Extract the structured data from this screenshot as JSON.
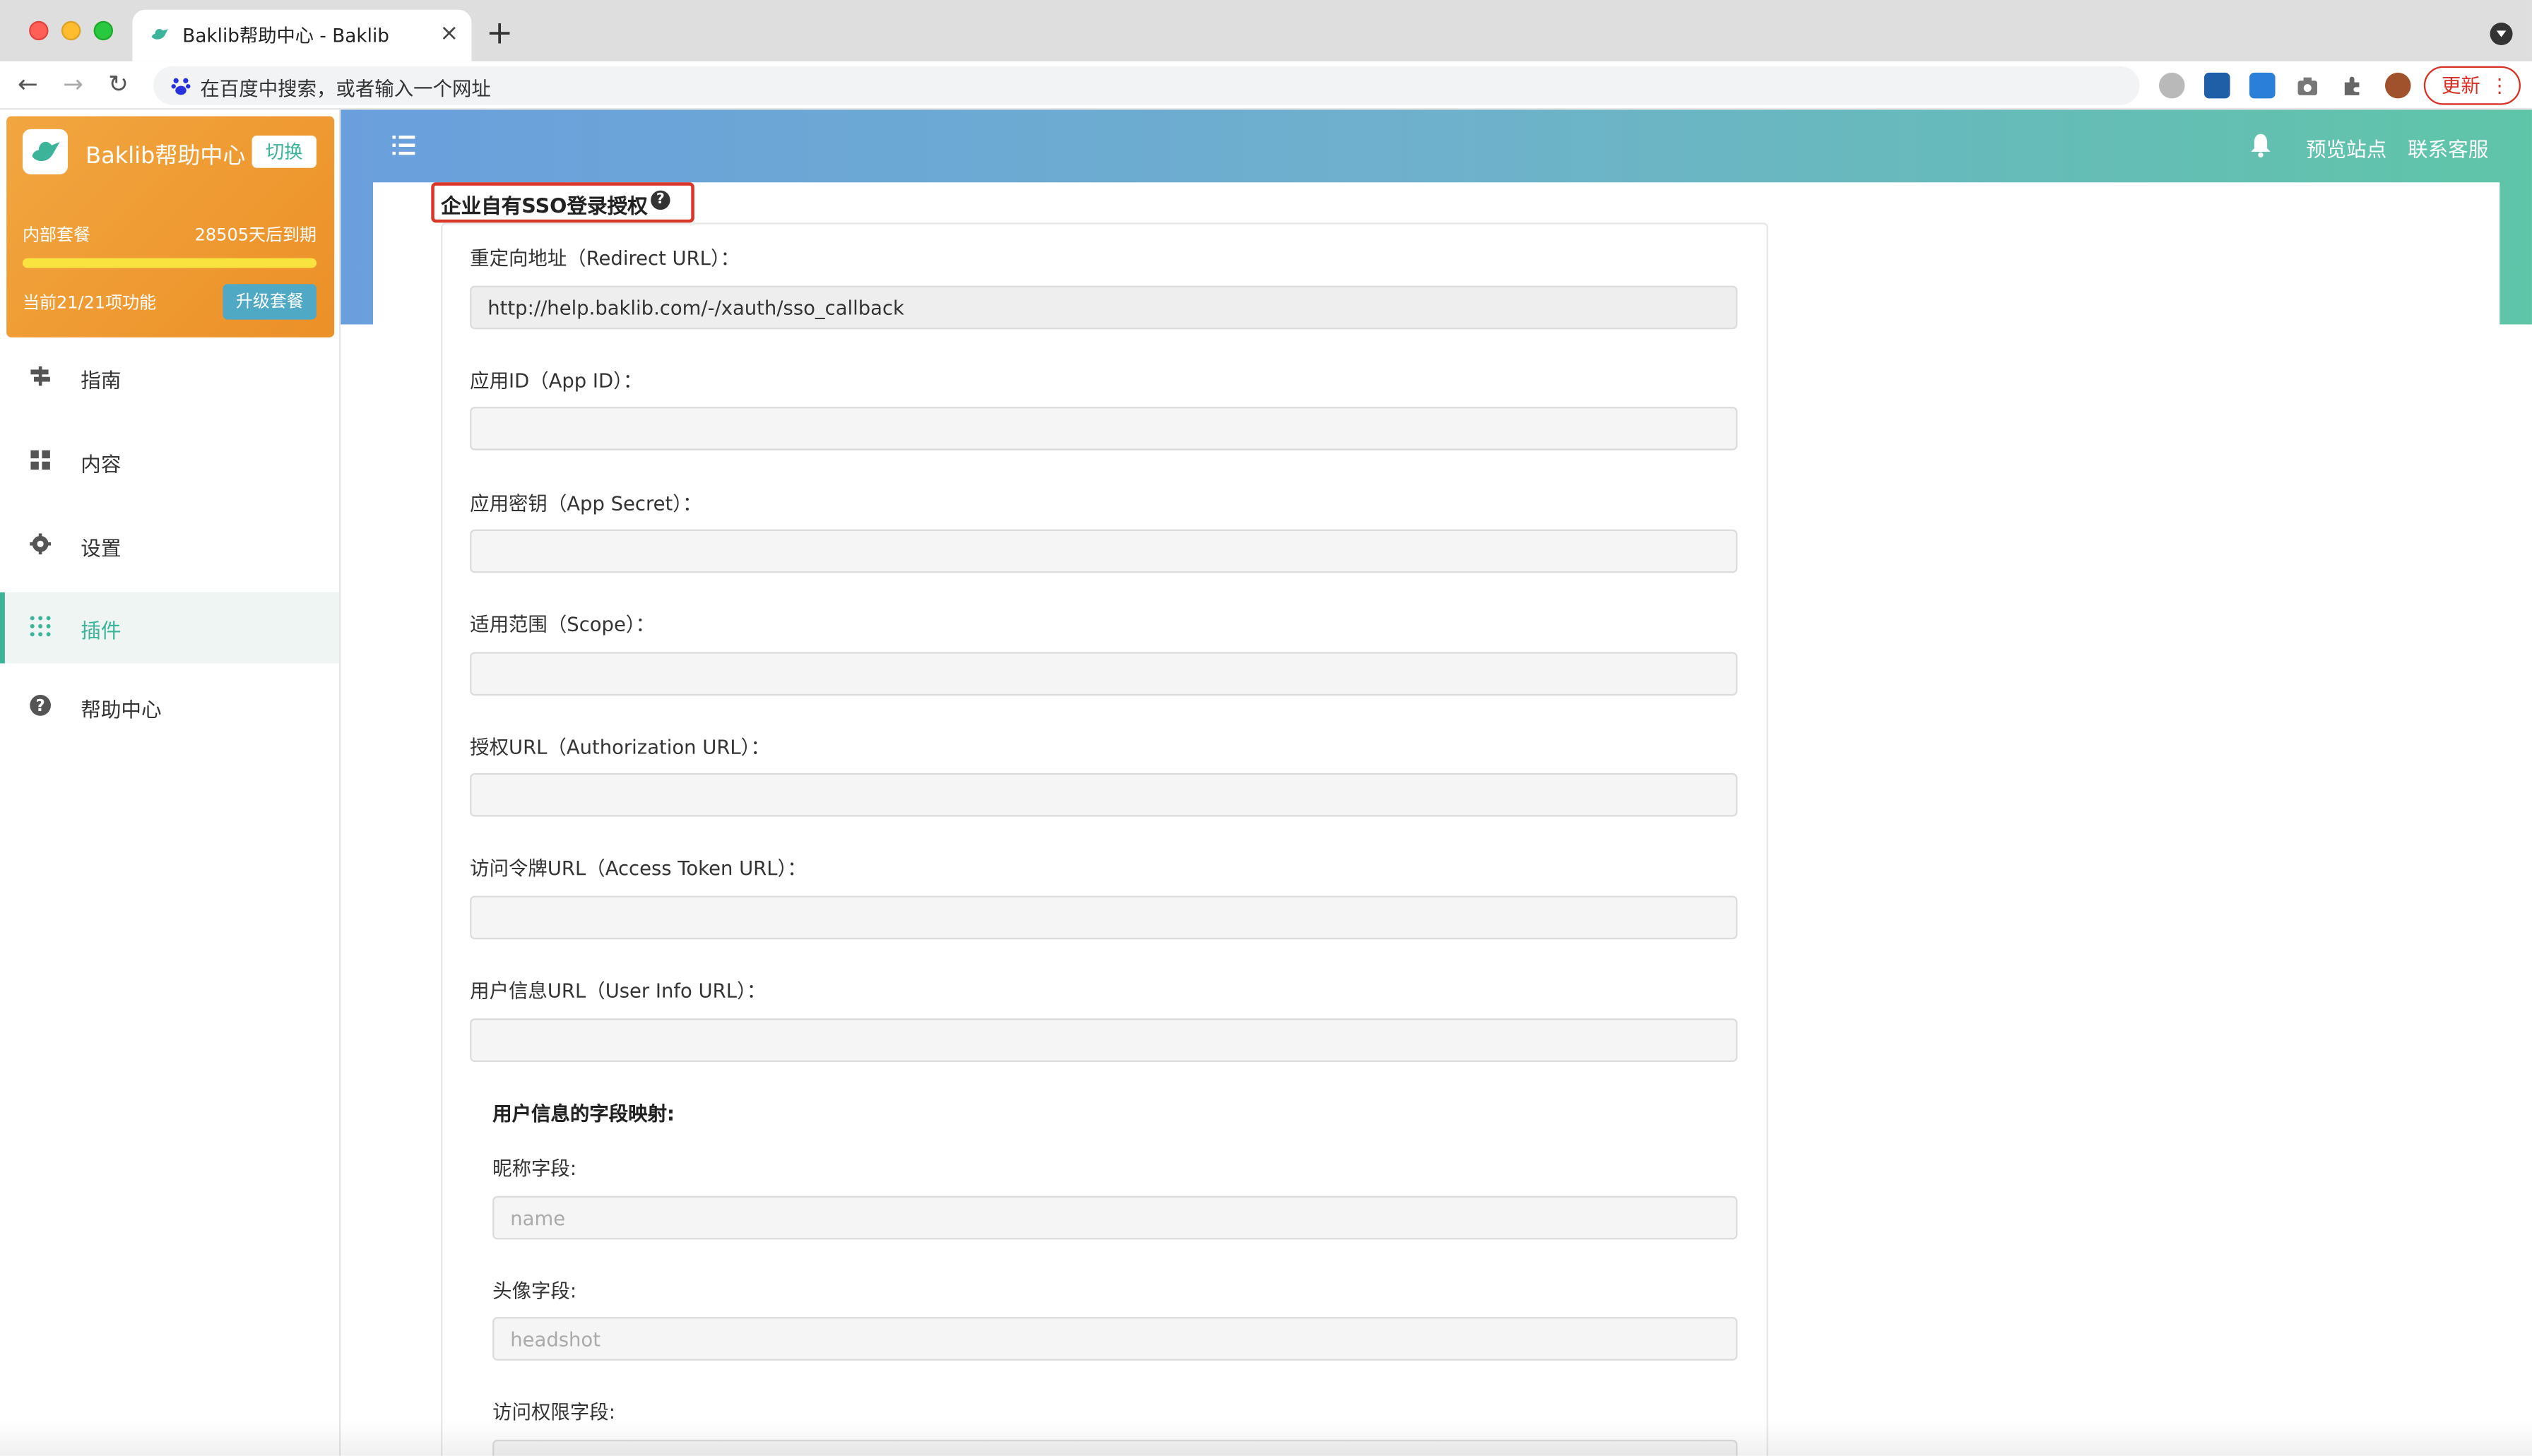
{
  "browser": {
    "tab_title": "Baklib帮助中心 - Baklib",
    "tab_close": "×",
    "new_tab": "+",
    "omnibox_text": "在百度中搜索，或者输入一个网址",
    "update_label": "更新",
    "update_more": "⋮",
    "back": "←",
    "forward": "→",
    "reload": "↻"
  },
  "plan": {
    "site_name": "Baklib帮助中心",
    "switch_label": "切换",
    "plan_name": "内部套餐",
    "expire_text": "28505天后到期",
    "progress": 1.0,
    "features_text": "当前21/21项功能",
    "upgrade_label": "升级套餐"
  },
  "menu": [
    {
      "label": "指南",
      "icon": "signpost-icon",
      "active": false
    },
    {
      "label": "内容",
      "icon": "grid-icon",
      "active": false
    },
    {
      "label": "设置",
      "icon": "gear-icon",
      "active": false
    },
    {
      "label": "插件",
      "icon": "apps-icon",
      "active": true
    },
    {
      "label": "帮助中心",
      "icon": "question-icon",
      "active": false
    }
  ],
  "topbar": {
    "preview_label": "预览站点",
    "support_label": "联系客服"
  },
  "section": {
    "title": "企业自有SSO登录授权",
    "help_glyph": "?"
  },
  "form": {
    "redirect_label": "重定向地址（Redirect URL）：",
    "redirect_value": "http://help.baklib.com/-/xauth/sso_callback",
    "app_id_label": "应用ID（App ID）：",
    "app_secret_label": "应用密钥（App Secret）：",
    "scope_label": "适用范围（Scope）：",
    "auth_url_label": "授权URL（Authorization URL）：",
    "token_url_label": "访问令牌URL（Access Token URL）：",
    "userinfo_url_label": "用户信息URL（User Info URL）：",
    "mapping_title": "用户信息的字段映射:",
    "nickname_label": "昵称字段:",
    "nickname_placeholder": "name",
    "avatar_label": "头像字段:",
    "avatar_placeholder": "headshot",
    "access_label": "访问权限字段:"
  },
  "colors": {
    "accent": "#3bb49a",
    "plan_orange": "#ee9a30",
    "highlight_red": "#d8372a"
  }
}
